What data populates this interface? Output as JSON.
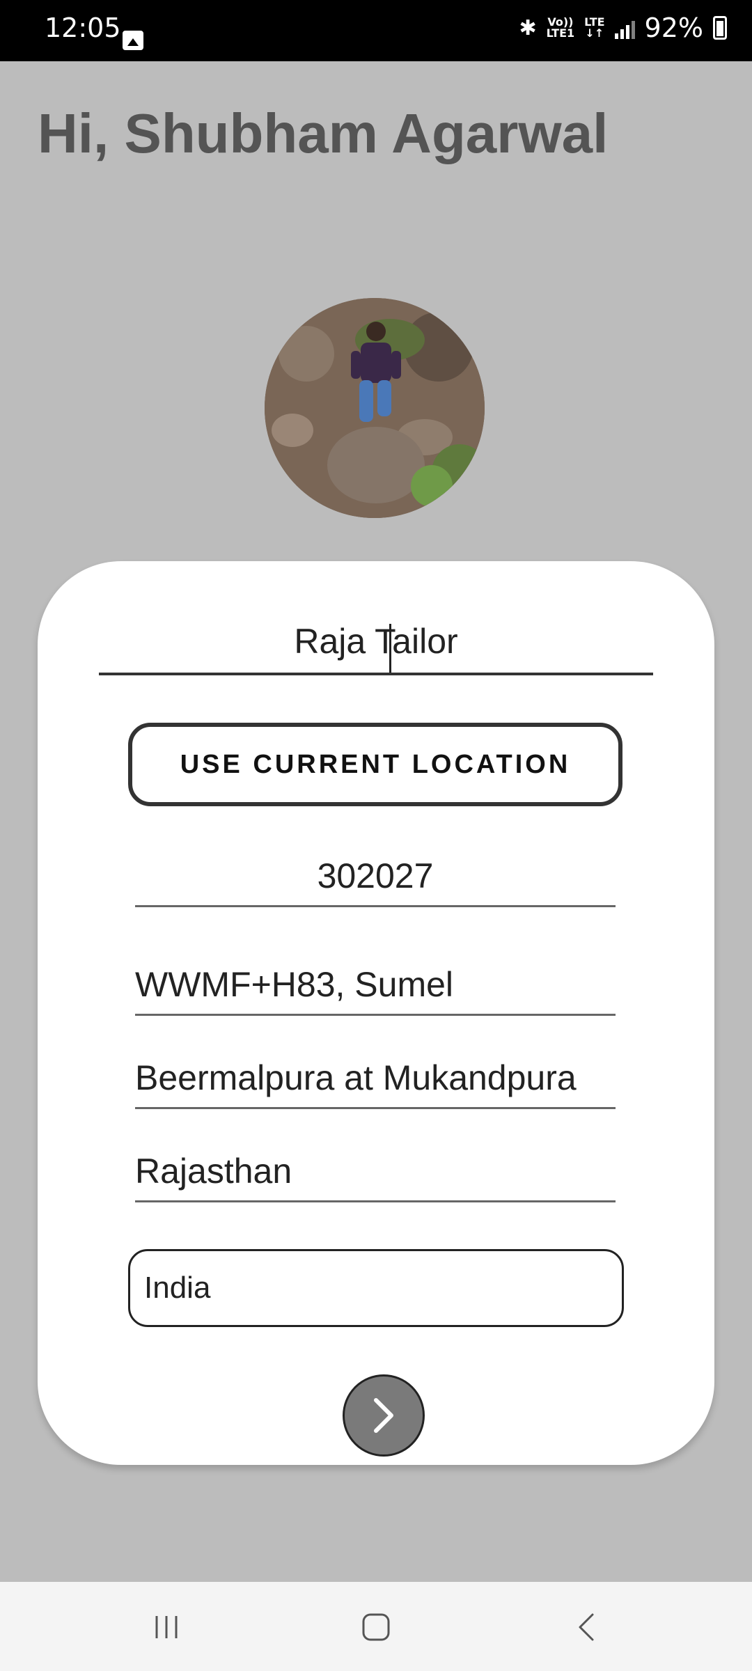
{
  "status_bar": {
    "time": "12:05",
    "network_top": "Vo))",
    "network_bottom": "LTE1",
    "lte_label": "LTE",
    "battery_percent": "92%",
    "icons": [
      "gallery-icon",
      "bluetooth-icon",
      "signal-icon",
      "battery-charging-icon"
    ]
  },
  "header": {
    "greeting": "Hi, Shubham Agarwal"
  },
  "profile": {
    "avatar_icon": "profile-photo"
  },
  "form": {
    "name_value": "Raja Tailor",
    "use_location_label": "USE CURRENT LOCATION",
    "pincode_value": "302027",
    "address_line1_value": "WWMF+H83, Sumel",
    "address_line2_value": "Beermalpura at Mukandpura",
    "state_value": "Rajasthan",
    "country_value": "India",
    "next_icon": "chevron-right-icon"
  },
  "nav_bar": {
    "icons": [
      "recents-icon",
      "home-icon",
      "back-icon"
    ]
  }
}
